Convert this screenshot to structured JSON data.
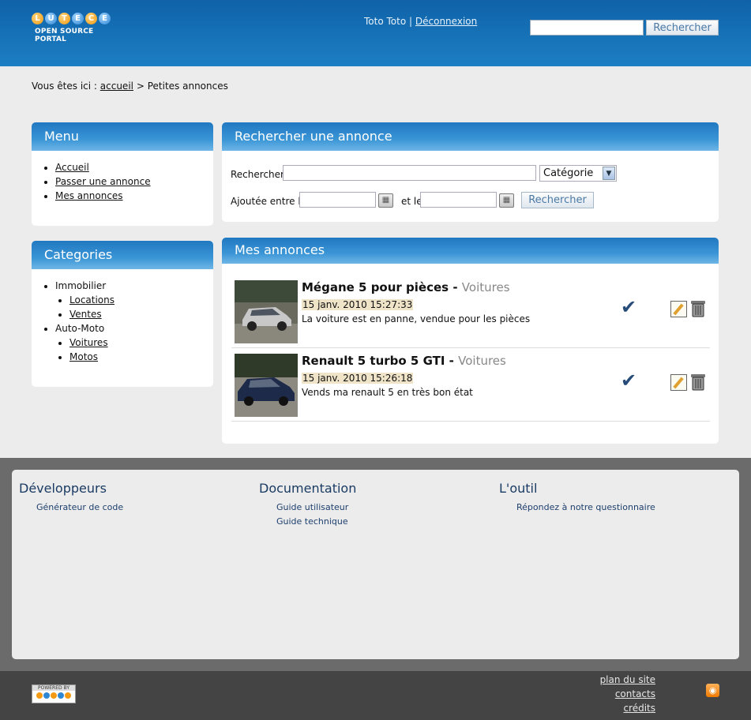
{
  "header": {
    "logo_letters": [
      "L",
      "U",
      "T",
      "E",
      "C",
      "E"
    ],
    "logo_subtitle": "OPEN SOURCE PORTAL",
    "user_name": "Toto Toto",
    "separator": "|",
    "logout_label": "Déconnexion",
    "search_value": "",
    "search_button": "Rechercher"
  },
  "breadcrumb": {
    "prefix": "Vous êtes ici :",
    "home": "accueil",
    "arrow": ">",
    "current": "Petites annonces"
  },
  "menu": {
    "title": "Menu",
    "items": [
      "Accueil",
      "Passer une annonce",
      "Mes annonces"
    ]
  },
  "categories": {
    "title": "Categories",
    "groups": [
      {
        "name": "Immobilier",
        "items": [
          "Locations",
          "Ventes"
        ]
      },
      {
        "name": "Auto-Moto",
        "items": [
          "Voitures",
          "Motos"
        ]
      }
    ]
  },
  "search_panel": {
    "title": "Rechercher une annonce",
    "search_label": "Rechercher",
    "search_value": "",
    "category_selected": "Catégorie",
    "date_from_label": "Ajoutée entre le",
    "date_to_label": "et le",
    "date_from_value": "",
    "date_to_value": "",
    "submit_label": "Rechercher"
  },
  "my_ads": {
    "title": "Mes annonces",
    "ads": [
      {
        "title": "Mégane 5 pour pièces",
        "dash": "-",
        "category": "Voitures",
        "date": "15 janv. 2010 15:27:33",
        "description": "La voiture est en panne, vendue pour les pièces"
      },
      {
        "title": "Renault 5 turbo 5 GTI",
        "dash": "-",
        "category": "Voitures",
        "date": "15 janv. 2010 15:26:18",
        "description": "Vends ma renault 5 en très bon état"
      }
    ]
  },
  "footer": {
    "columns": [
      {
        "title": "Développeurs",
        "links": [
          "Générateur de code"
        ]
      },
      {
        "title": "Documentation",
        "links": [
          "Guide utilisateur",
          "Guide technique"
        ]
      },
      {
        "title": "L'outil",
        "links": [
          "Répondez à notre questionnaire"
        ]
      }
    ],
    "powered_by": "POWERED BY",
    "bottom_links": [
      "plan du site",
      "contacts",
      "crédits"
    ]
  },
  "colors": {
    "header_blue": "#1d7fc4",
    "panel_head_blue": "#2178c0",
    "footer_dark": "#444444",
    "footer_link": "#1d3f6d"
  }
}
